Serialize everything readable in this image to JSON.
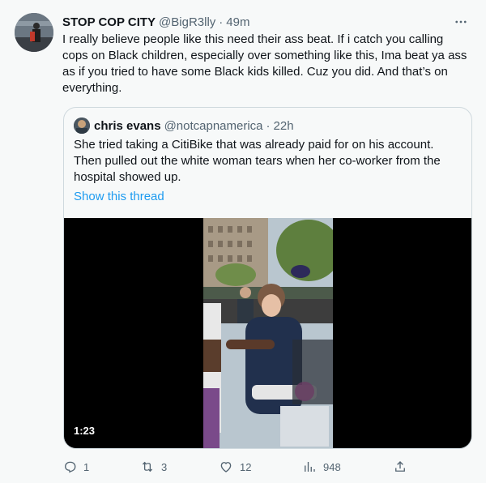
{
  "tweet": {
    "author_name": "STOP COP CITY",
    "handle": "@BigR3lly",
    "separator": "·",
    "time": "49m",
    "text": "I really believe people like this need their ass beat. If i catch you calling cops on Black children, especially over something like this, Ima beat ya ass as if you tried to have some Black kids killed. Cuz you did. And that’s on everything.",
    "more_icon": "more-horizontal-icon"
  },
  "quote": {
    "author_name": "chris evans",
    "handle": "@notcapnamerica",
    "separator": "·",
    "time": "22h",
    "text": "She tried taking a CitiBike that was already paid for on his account. Then pulled out the white woman tears when her co-worker from the hospital showed up.",
    "show_thread": "Show this thread",
    "video_duration": "1:23"
  },
  "actions": {
    "reply_count": "1",
    "retweet_count": "3",
    "like_count": "12",
    "views_count": "948"
  },
  "colors": {
    "background": "#f7f9f9",
    "text": "#0f1419",
    "secondary": "#536471",
    "link": "#1d9bf0",
    "border": "#cfd9de"
  }
}
